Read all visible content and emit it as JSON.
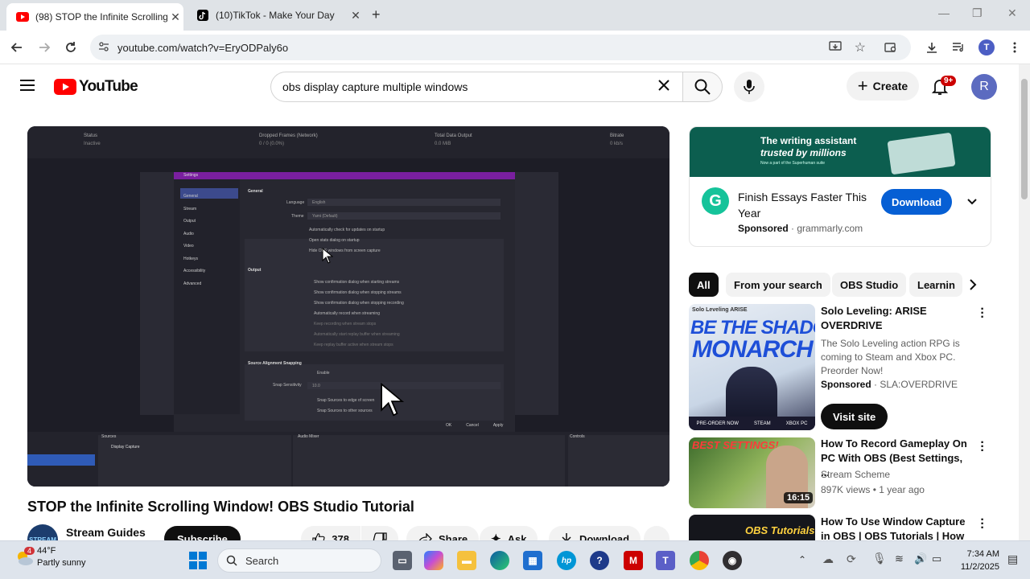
{
  "browser": {
    "tabs": [
      {
        "title": "(98) STOP the Infinite Scrolling",
        "icon": "youtube-icon"
      },
      {
        "title": "(10)TikTok - Make Your Day",
        "icon": "tiktok-icon"
      }
    ],
    "new_tab": "+",
    "address": "youtube.com/watch?v=EryODPaly6o",
    "profile_initial": "T"
  },
  "youtube": {
    "logo_text": "YouTube",
    "search_query": "obs display capture multiple windows",
    "create_label": "Create",
    "notifications_badge": "9+",
    "avatar_initial": "R"
  },
  "player_screenshot": {
    "top_labels": [
      "Status",
      "Dropped Frames (Network)",
      "Total Data Output",
      "Bitrate"
    ],
    "top_values": [
      "Inactive",
      "0 / 0 (0.0%)",
      "0.0 MiB",
      "0 kb/s"
    ],
    "dialog_title": "Settings",
    "sidebar": [
      "General",
      "Stream",
      "Output",
      "Audio",
      "Video",
      "Hotkeys",
      "Accessibility",
      "Advanced"
    ],
    "section_general": "General",
    "language_label": "Language",
    "language_value": "English",
    "theme_label": "Theme",
    "theme_value": "Yami (Default)",
    "general_checks": [
      "Automatically check for updates on startup",
      "Open stats dialog on startup",
      "Hide OBS windows from screen capture"
    ],
    "section_output": "Output",
    "output_checks": [
      "Show confirmation dialog when starting streams",
      "Show confirmation dialog when stopping streams",
      "Show confirmation dialog when stopping recording",
      "Automatically record when streaming",
      "Keep recording when stream stops",
      "Automatically start replay buffer when streaming",
      "Keep replay buffer active when stream stops"
    ],
    "section_snap": "Source Alignment Snapping",
    "snap_enable": "Enable",
    "snap_sensitivity_label": "Snap Sensitivity",
    "snap_sensitivity_value": "10.0",
    "snap_checks": [
      "Snap Sources to edge of screen",
      "Snap Sources to other sources"
    ],
    "dialog_buttons": [
      "OK",
      "Cancel",
      "Apply"
    ],
    "bottom_docks": [
      "Sources",
      "Audio Mixer",
      "Controls"
    ],
    "source_item": "Display Capture"
  },
  "video": {
    "title": "STOP the Infinite Scrolling Window! OBS Studio Tutorial",
    "channel": "Stream Guides",
    "channel_avatar_text": "STREAM",
    "subscribe_label": "Subscribe",
    "likes": "378",
    "share_label": "Share",
    "ask_label": "Ask",
    "download_label": "Download",
    "more_label": "..."
  },
  "ad_banner": {
    "headline_line1": "The writing assistant",
    "headline_line2": "trusted by millions",
    "small_note": "Now a part of the Superhuman suite",
    "logo_letter": "G",
    "title": "Finish Essays Faster This Year",
    "sponsored": "Sponsored",
    "domain": "grammarly.com",
    "cta": "Download"
  },
  "chips": [
    "All",
    "From your search",
    "OBS Studio",
    "Learnin"
  ],
  "recommendations": [
    {
      "title": "Solo Leveling: ARISE OVERDRIVE",
      "desc": "The Solo Leveling action RPG is coming to Steam and Xbox PC. Preorder Now!",
      "sponsored": "Sponsored",
      "advertiser": "SLA:OVERDRIVE",
      "cta": "Visit site",
      "thumb_text_1": "BE THE SHADOW",
      "thumb_text_2": "MONARCH",
      "thumb_logo": "Solo Leveling ARISE",
      "thumb_footer": [
        "PRE-ORDER NOW",
        "STEAM",
        "XBOX PC"
      ]
    },
    {
      "title": "How To Record Gameplay On PC With OBS (Best Settings, ...",
      "channel": "Stream Scheme",
      "meta": "897K views • 1 year ago",
      "duration": "16:15",
      "thumb_text": "BEST SETTINGS!"
    },
    {
      "title": "How To Use Window Capture in OBS | OBS Tutorials | How to fi...",
      "thumb_text": "OBS Tutorials"
    }
  ],
  "taskbar": {
    "weather_temp": "44°F",
    "weather_desc": "Partly sunny",
    "weather_badge": "4",
    "search_placeholder": "Search",
    "time": "7:34 AM",
    "date": "11/2/2025"
  },
  "colors": {
    "youtube_red": "#ff0000",
    "download_blue": "#065fd4",
    "chip_selected": "#0f0f0f",
    "grammarly_green": "#15c39a",
    "ad_banner_bg": "#0c5e4f",
    "taskbar_bg": "#dee4ec",
    "obs_dialog_accent": "#7a1fa0"
  }
}
